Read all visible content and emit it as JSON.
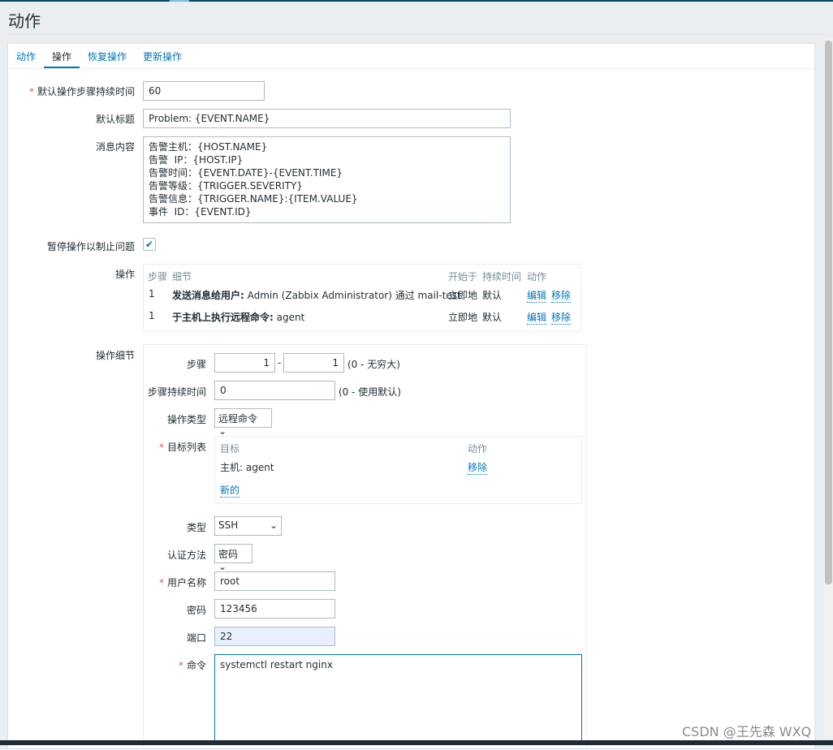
{
  "page_title": "动作",
  "tabs": [
    "动作",
    "操作",
    "恢复操作",
    "更新操作"
  ],
  "form": {
    "default_step_duration": {
      "label": "默认操作步骤持续时间",
      "value": "60"
    },
    "default_subject": {
      "label": "默认标题",
      "value": "Problem: {EVENT.NAME}"
    },
    "message": {
      "label": "消息内容",
      "value": "告警主机：{HOST.NAME}\n告警  IP：{HOST.IP}\n告警时间：{EVENT.DATE}-{EVENT.TIME}\n告警等级：{TRIGGER.SEVERITY}\n告警信息：{TRIGGER.NAME}:{ITEM.VALUE}\n事件  ID：{EVENT.ID}"
    },
    "pause": {
      "label": "暂停操作以制止问题",
      "checked": true
    },
    "operations": {
      "label": "操作",
      "headers": [
        "步骤",
        "细节",
        "开始于",
        "持续时间",
        "动作"
      ],
      "rows": [
        {
          "step": "1",
          "detail_bold": "发送消息给用户:",
          "detail": " Admin (Zabbix Administrator) 通过 mail-test",
          "start": "立即地",
          "duration": "默认",
          "edit": "编辑",
          "remove": "移除"
        },
        {
          "step": "1",
          "detail_bold": "于主机上执行远程命令:",
          "detail": " agent",
          "start": "立即地",
          "duration": "默认",
          "edit": "编辑",
          "remove": "移除"
        }
      ]
    }
  },
  "details": {
    "label": "操作细节",
    "steps": {
      "label": "步骤",
      "from": "1",
      "to": "1",
      "dash": "-",
      "hint": "(0 - 无穷大)"
    },
    "step_duration": {
      "label": "步骤持续时间",
      "value": "0",
      "hint": "(0 - 使用默认)"
    },
    "op_type": {
      "label": "操作类型",
      "value": "远程命令"
    },
    "targets": {
      "label": "目标列表",
      "headers": [
        "目标",
        "动作"
      ],
      "row": {
        "target": "主机: agent",
        "action": "移除"
      },
      "new": "新的"
    },
    "type": {
      "label": "类型",
      "value": "SSH"
    },
    "auth": {
      "label": "认证方法",
      "value": "密码"
    },
    "username": {
      "label": "用户名称",
      "value": "root"
    },
    "password": {
      "label": "密码",
      "value": "123456"
    },
    "port": {
      "label": "端口",
      "value": "22"
    },
    "command": {
      "label": "命令",
      "value": "systemctl restart nginx"
    }
  },
  "watermark": "CSDN @王先森 WXQ"
}
